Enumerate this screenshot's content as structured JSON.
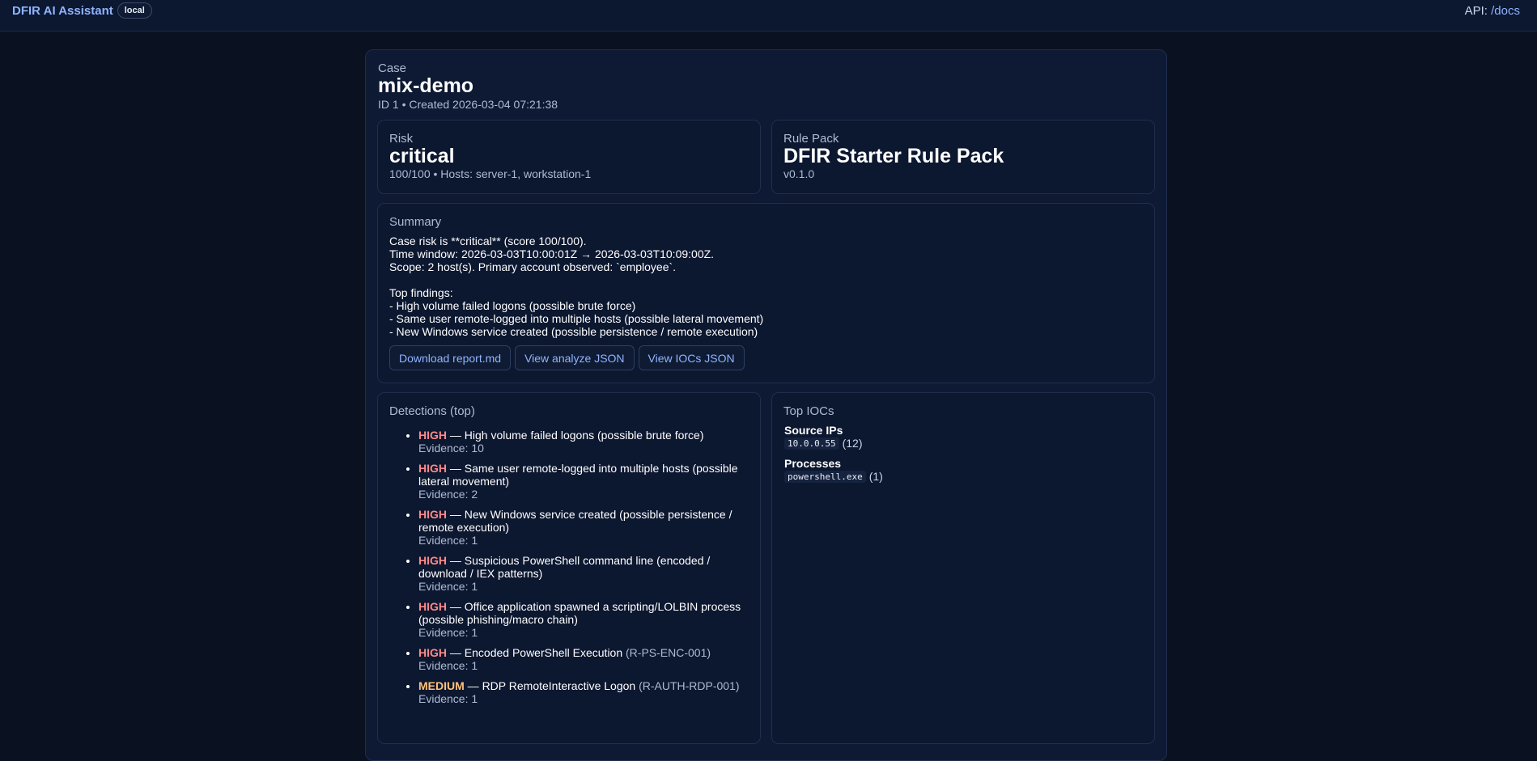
{
  "header": {
    "title": "DFIR AI Assistant",
    "badge": "local",
    "api_prefix": "API:",
    "api_link": "/docs"
  },
  "case": {
    "label": "Case",
    "name": "mix-demo",
    "meta": "ID 1 • Created 2026-03-04 07:21:38"
  },
  "risk": {
    "label": "Risk",
    "level": "critical",
    "detail": "100/100 • Hosts: server-1, workstation-1"
  },
  "rule_pack": {
    "label": "Rule Pack",
    "name": "DFIR Starter Rule Pack",
    "version": "v0.1.0"
  },
  "summary": {
    "label": "Summary",
    "text": "Case risk is **critical** (score 100/100).\nTime window: 2026-03-03T10:00:01Z → 2026-03-03T10:09:00Z.\nScope: 2 host(s). Primary account observed: `employee`.\n\nTop findings:\n- High volume failed logons (possible brute force)\n- Same user remote-logged into multiple hosts (possible lateral movement)\n- New Windows service created (possible persistence / remote execution)",
    "buttons": {
      "download_report": "Download report.md",
      "view_analyze": "View analyze JSON",
      "view_iocs": "View IOCs JSON"
    }
  },
  "detections": {
    "label": "Detections (top)",
    "items": [
      {
        "severity": "HIGH",
        "sep": " — ",
        "title": "High volume failed logons (possible brute force)",
        "rule": "",
        "evidence": "Evidence: 10"
      },
      {
        "severity": "HIGH",
        "sep": " — ",
        "title": "Same user remote-logged into multiple hosts (possible lateral movement)",
        "rule": "",
        "evidence": "Evidence: 2"
      },
      {
        "severity": "HIGH",
        "sep": " — ",
        "title": "New Windows service created (possible persistence / remote execution)",
        "rule": "",
        "evidence": "Evidence: 1"
      },
      {
        "severity": "HIGH",
        "sep": " — ",
        "title": "Suspicious PowerShell command line (encoded / download / IEX patterns)",
        "rule": "",
        "evidence": "Evidence: 1"
      },
      {
        "severity": "HIGH",
        "sep": " — ",
        "title": "Office application spawned a scripting/LOLBIN process (possible phishing/macro chain)",
        "rule": "",
        "evidence": "Evidence: 1"
      },
      {
        "severity": "HIGH",
        "sep": " — ",
        "title": "Encoded PowerShell Execution",
        "rule": "(R-PS-ENC-001)",
        "evidence": "Evidence: 1"
      },
      {
        "severity": "MEDIUM",
        "sep": " — ",
        "title": "RDP RemoteInteractive Logon",
        "rule": "(R-AUTH-RDP-001)",
        "evidence": "Evidence: 1"
      }
    ]
  },
  "iocs": {
    "label": "Top IOCs",
    "source_ips_label": "Source IPs",
    "source_ip": "10.0.0.55",
    "source_ip_count": "(12)",
    "processes_label": "Processes",
    "process": "powershell.exe",
    "process_count": "(1)"
  },
  "colors": {
    "background": "#0a1120",
    "card": "#0c1730",
    "accent": "#8fb4ff",
    "high": "#ff8a8a",
    "medium": "#ffc27a"
  }
}
